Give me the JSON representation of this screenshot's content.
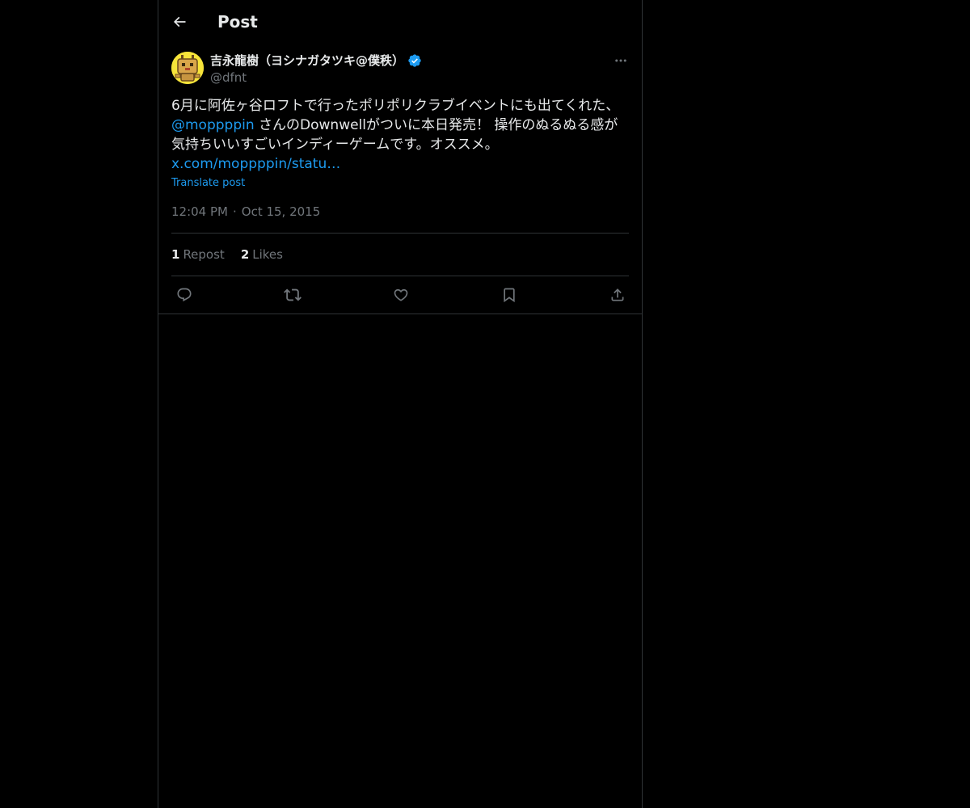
{
  "header": {
    "title": "Post",
    "back_icon": "arrow-left-icon"
  },
  "author": {
    "display_name": "吉永龍樹（ヨシナガタツキ@僕秩）",
    "handle": "@dfnt",
    "verified": true,
    "verified_color": "#1d9bf0",
    "avatar_icon": "yellow-robot-avatar"
  },
  "post": {
    "text_line1": "6月に阿佐ヶ谷ロフトで行ったポリポリクラブイベントにも出てくれた、",
    "mention": "@moppppin",
    "text_line2": " さんのDownwellがついに本日発売！ 操作のぬるぬる感が気持ちいいすごいインディーゲームです。オススメ。",
    "link": "x.com/moppppin/statu…",
    "translate_label": "Translate post",
    "time": "12:04 PM",
    "separator": "·",
    "date": "Oct 15, 2015"
  },
  "stats": {
    "reposts_count": "1",
    "reposts_label": "Repost",
    "likes_count": "2",
    "likes_label": "Likes"
  },
  "actions": [
    "reply-icon",
    "repost-icon",
    "like-icon",
    "bookmark-icon",
    "share-icon"
  ],
  "colors": {
    "background": "#000000",
    "text": "#e7e9ea",
    "muted": "#71767b",
    "accent": "#1d9bf0",
    "border": "#2f3336"
  }
}
